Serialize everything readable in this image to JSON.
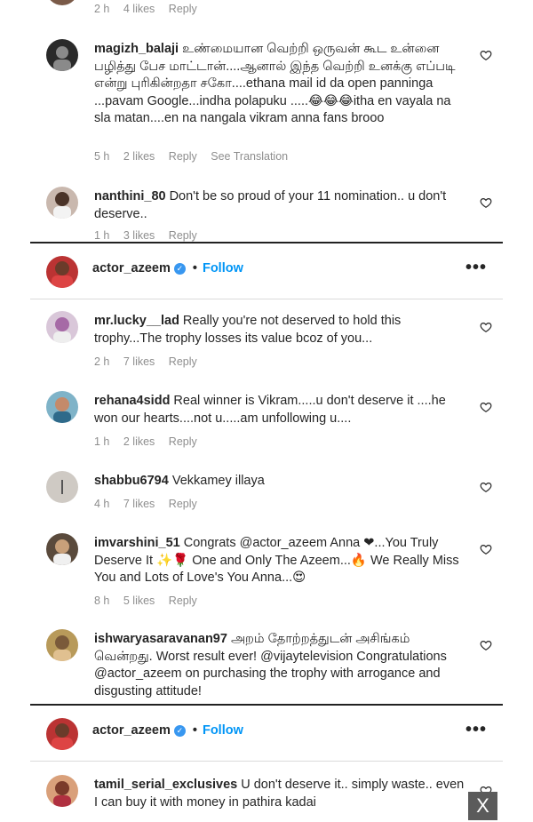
{
  "comments_top": [
    {
      "meta": {
        "time": "2 h",
        "likes": "4 likes",
        "reply": "Reply"
      }
    },
    {
      "user": "magizh_balaji",
      "text": "உண்மையான வெற்றி ஒருவன் கூட உன்னை பழித்து பேச மாட்டான்....ஆனால் இந்த வெற்றி உனக்கு எப்படி என்று புரிகின்றதா சகோ....ethana mail id da open panninga ...pavam Google...indha polapuku .....😂😂😂itha en vayala na sla matan....en na nangala vikram anna fans brooo",
      "time": "5 h",
      "likes": "2 likes",
      "reply": "Reply",
      "extra": "See Translation"
    },
    {
      "user": "nanthini_80",
      "text": "Don't be so proud of your 11 nomination.. u don't deserve..",
      "time": "1 h",
      "likes": "3 likes",
      "reply": "Reply"
    }
  ],
  "post1": {
    "username": "actor_azeem",
    "follow": "Follow",
    "dot": "•",
    "more": "•••"
  },
  "comments_mid": [
    {
      "user": "mr.lucky__lad",
      "text": "Really you're not deserved to hold this trophy...The trophy losses its value bcoz of you...",
      "time": "2 h",
      "likes": "7 likes",
      "reply": "Reply"
    },
    {
      "user": "rehana4sidd",
      "text": "Real winner is Vikram.....u don't deserve it ....he won our hearts....not u.....am unfollowing u....",
      "time": "1 h",
      "likes": "2 likes",
      "reply": "Reply"
    },
    {
      "user": "shabbu6794",
      "text": "Vekkamey illaya",
      "time": "4 h",
      "likes": "7 likes",
      "reply": "Reply"
    },
    {
      "user": "imvarshini_51",
      "text": "Congrats @actor_azeem Anna ❤...You Truly Deserve It ✨🌹 One and Only The Azeem...🔥 We Really Miss You and Lots of Love's You Anna...😍",
      "time": "8 h",
      "likes": "5 likes",
      "reply": "Reply"
    },
    {
      "user": "ishwaryasaravanan97",
      "text": "அறம் தோற்றத்துடன் அசிங்கம் வென்றது. Worst result ever! @vijaytelevision Congratulations @actor_azeem on purchasing the trophy with arrogance and disgusting attitude!"
    }
  ],
  "post2": {
    "username": "actor_azeem",
    "follow": "Follow",
    "dot": "•",
    "more": "•••"
  },
  "comments_bottom": [
    {
      "user": "tamil_serial_exclusives",
      "text": "U don't deserve it.. simply waste.. even I can buy it with money in pathira kadai"
    }
  ],
  "close_label": "X",
  "icons": {
    "heart": "heart-outline-icon",
    "verified": "verified-badge-icon",
    "more": "more-options-icon"
  }
}
